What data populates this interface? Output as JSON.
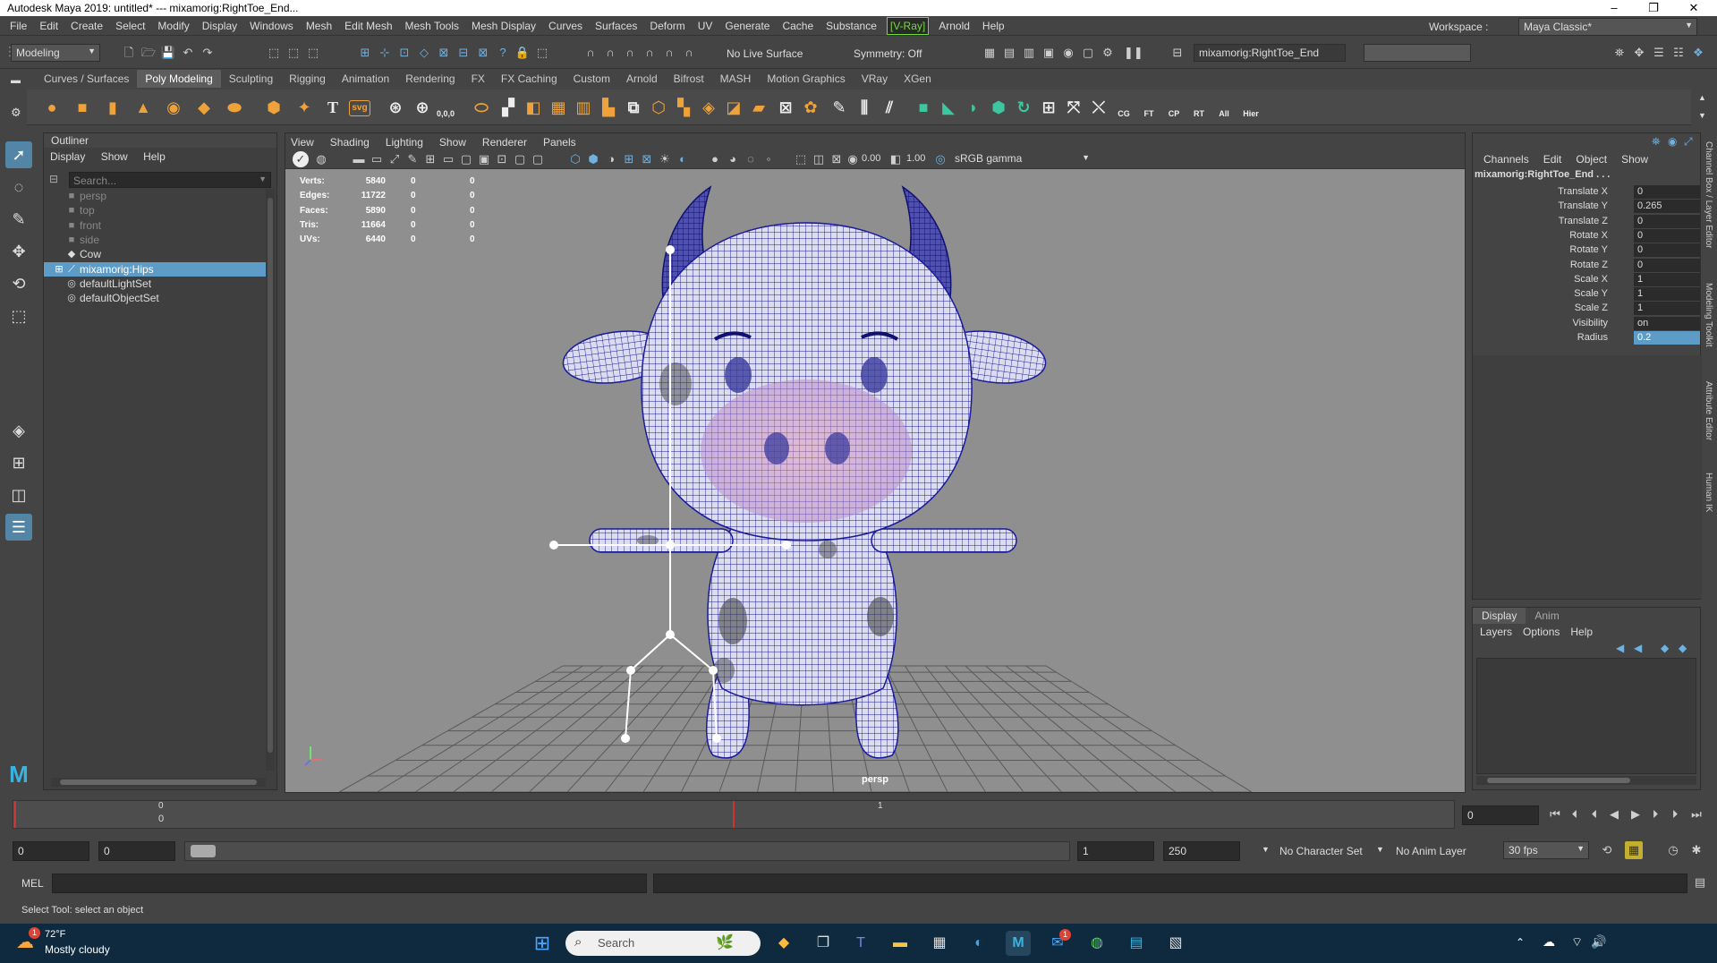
{
  "title_bar": {
    "title": "Autodesk Maya 2019: untitled*   ---   mixamorig:RightToe_End...",
    "minimize": "–",
    "maximize": "❐",
    "close": "✕"
  },
  "menu_bar": {
    "items": [
      "File",
      "Edit",
      "Create",
      "Select",
      "Modify",
      "Display",
      "Windows",
      "Mesh",
      "Edit Mesh",
      "Mesh Tools",
      "Mesh Display",
      "Curves",
      "Surfaces",
      "Deform",
      "UV",
      "Generate",
      "Cache",
      "Substance",
      "[V-Ray]",
      "Arnold",
      "Help"
    ],
    "workspace_label": "Workspace :",
    "workspace_value": "Maya Classic*"
  },
  "status_line": {
    "menuset": "Modeling",
    "live_surface": "No Live Surface",
    "symmetry": "Symmetry: Off",
    "selection_field": "mixamorig:RightToe_End"
  },
  "shelf": {
    "tabs": [
      "Curves / Surfaces",
      "Poly Modeling",
      "Sculpting",
      "Rigging",
      "Animation",
      "Rendering",
      "FX",
      "FX Caching",
      "Custom",
      "Arnold",
      "Bifrost",
      "MASH",
      "Motion Graphics",
      "VRay",
      "XGen"
    ],
    "active_tab": "Poly Modeling",
    "labeled_icons": [
      "CG",
      "FT",
      "CP",
      "RT",
      "All",
      "Hier"
    ],
    "svg_label": "svg",
    "text_label": "T",
    "coords_label": "0,0,0"
  },
  "outliner": {
    "title": "Outliner",
    "menus": [
      "Display",
      "Show",
      "Help"
    ],
    "search_placeholder": "Search...",
    "items": [
      {
        "label": "persp",
        "icon": "camera-icon",
        "dim": true
      },
      {
        "label": "top",
        "icon": "camera-icon",
        "dim": true
      },
      {
        "label": "front",
        "icon": "camera-icon",
        "dim": true
      },
      {
        "label": "side",
        "icon": "camera-icon",
        "dim": true
      },
      {
        "label": "Cow",
        "icon": "mesh-icon",
        "dim": false
      },
      {
        "label": "mixamorig:Hips",
        "icon": "joint-icon",
        "dim": false,
        "selected": true
      },
      {
        "label": "defaultLightSet",
        "icon": "set-icon",
        "dim": false
      },
      {
        "label": "defaultObjectSet",
        "icon": "set-icon",
        "dim": false
      }
    ]
  },
  "viewport": {
    "menus": [
      "View",
      "Shading",
      "Lighting",
      "Show",
      "Renderer",
      "Panels"
    ],
    "exposure": "0.00",
    "gamma": "1.00",
    "color_space": "sRGB gamma",
    "camera_label": "persp",
    "hud": [
      {
        "label": "Verts:",
        "v1": "5840",
        "v2": "0",
        "v3": "0"
      },
      {
        "label": "Edges:",
        "v1": "11722",
        "v2": "0",
        "v3": "0"
      },
      {
        "label": "Faces:",
        "v1": "5890",
        "v2": "0",
        "v3": "0"
      },
      {
        "label": "Tris:",
        "v1": "11664",
        "v2": "0",
        "v3": "0"
      },
      {
        "label": "UVs:",
        "v1": "6440",
        "v2": "0",
        "v3": "0"
      }
    ],
    "mesh_color": "#1a1a9c",
    "mesh_fill": "#dcdcf0"
  },
  "channel_box": {
    "menus": [
      "Channels",
      "Edit",
      "Object",
      "Show"
    ],
    "object_name": "mixamorig:RightToe_End . . .",
    "attributes": [
      {
        "name": "Translate X",
        "value": "0"
      },
      {
        "name": "Translate Y",
        "value": "0.265"
      },
      {
        "name": "Translate Z",
        "value": "0"
      },
      {
        "name": "Rotate X",
        "value": "0"
      },
      {
        "name": "Rotate Y",
        "value": "0"
      },
      {
        "name": "Rotate Z",
        "value": "0"
      },
      {
        "name": "Scale X",
        "value": "1"
      },
      {
        "name": "Scale Y",
        "value": "1"
      },
      {
        "name": "Scale Z",
        "value": "1"
      },
      {
        "name": "Visibility",
        "value": "on"
      },
      {
        "name": "Radius",
        "value": "0.2",
        "highlight": true
      }
    ]
  },
  "layer_editor": {
    "tabs": [
      "Display",
      "Anim"
    ],
    "active_tab": "Display",
    "menus": [
      "Layers",
      "Options",
      "Help"
    ]
  },
  "side_tabs": [
    "Channel Box / Layer Editor",
    "Modeling Toolkit",
    "Attribute Editor",
    "Human IK"
  ],
  "time_slider": {
    "start_marker": "0",
    "tick_0": "0",
    "tick_1": "1",
    "current_frame": "0"
  },
  "range_slider": {
    "start": "0",
    "inner_start": "0",
    "inner_end": "1",
    "end": "250",
    "character_set": "No Character Set",
    "anim_layer": "No Anim Layer",
    "fps": "30 fps"
  },
  "command_line": {
    "label": "MEL"
  },
  "help_line": {
    "text": "Select Tool: select an object"
  },
  "taskbar": {
    "weather_temp": "72°F",
    "weather_desc": "Mostly cloudy",
    "weather_badge": "1",
    "search_placeholder": "Search",
    "mail_badge": "1"
  }
}
